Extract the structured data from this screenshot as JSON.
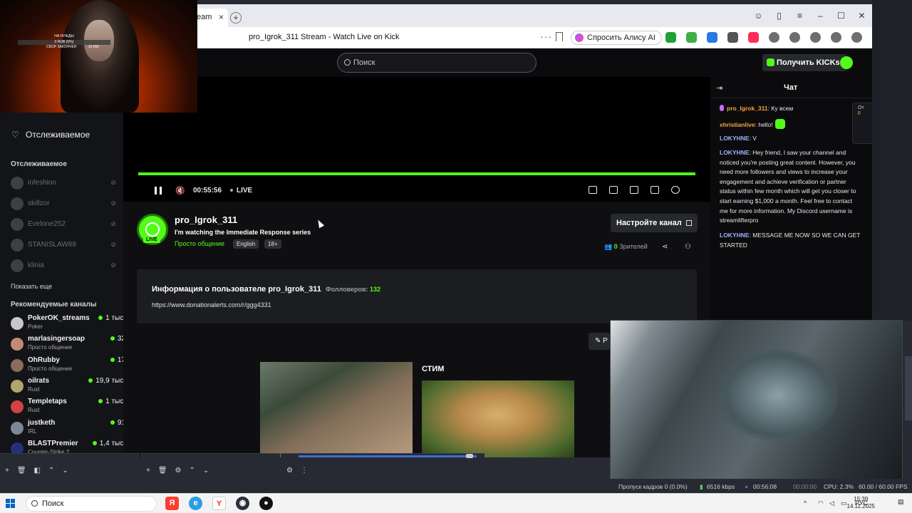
{
  "browser": {
    "tab_label": "eam",
    "tab_close": "×",
    "new_tab": "+",
    "page_title": "pro_Igrok_311 Stream - Watch Live on Kick",
    "alice_label": "Спросить Алису AI",
    "win_controls": [
      "☺",
      "▯",
      "≡",
      "–",
      "☐",
      "✕"
    ],
    "ext_colors": [
      "#21a038",
      "#3fae45",
      "#2a7ae2",
      "#555555",
      "#ff2d55",
      "#555555",
      "#555555",
      "#555555",
      "#555555",
      "#555555"
    ]
  },
  "kick": {
    "search_placeholder": "Поиск",
    "get_kicks_label": "Получить KICKs",
    "accent": "#53fc18"
  },
  "sidebar": {
    "following_link": "Отслеживаемое",
    "following_header": "Отслеживаемое",
    "offline": [
      "infeshion",
      "skillzor",
      "Evelone252",
      "STANISLAW89",
      "klinia"
    ],
    "show_more": "Показать еще",
    "recommended_header": "Рекомендуемые каналы",
    "recommended": [
      {
        "name": "PokerOK_streams",
        "category": "Poker",
        "viewers": "1 тыс.",
        "color": "#c8c8c8"
      },
      {
        "name": "marlasingersoap",
        "category": "Просто общение",
        "viewers": "32",
        "color": "#c28a73"
      },
      {
        "name": "OhRubby",
        "category": "Просто общение",
        "viewers": "17",
        "color": "#8b6b5c"
      },
      {
        "name": "oilrats",
        "category": "Rust",
        "viewers": "19,9 тыс.",
        "color": "#b0a56a"
      },
      {
        "name": "Templetaps",
        "category": "Rust",
        "viewers": "1 тыс.",
        "color": "#d34242"
      },
      {
        "name": "justketh",
        "category": "IRL",
        "viewers": "91",
        "color": "#7b8794"
      },
      {
        "name": "BLASTPremier",
        "category": "Counter-Strike 2",
        "viewers": "1,4 тыс.",
        "color": "#26307a"
      }
    ]
  },
  "webcam": {
    "overlay_line1": "НА НУЖДЫ",
    "overlay_line2": "0 RUB (0%)",
    "overlay_line3": "СБОР ЗАКОНЧЕН",
    "overlay_line4": "10 000"
  },
  "player": {
    "time": "00:55:56",
    "live_label": "LIVE",
    "progress": 1.0
  },
  "channel": {
    "name": "pro_Igrok_311",
    "stream_title": "I'm watching the Immediate Response series",
    "category": "Просто общение",
    "tags": [
      "English",
      "18+"
    ],
    "live_badge": "LIVE",
    "setup_button": "Настройте канал",
    "viewers_count": "0",
    "viewers_label": "Зрителей",
    "about_title": "Информация о пользователе pro_Igrok_311",
    "followers_label": "Фолловеров:",
    "followers_count": "132",
    "link": "https://www.donationalerts.com/r/ggg4331",
    "edit_label": "✎ Р",
    "panel_title": "СТИМ"
  },
  "chat": {
    "title": "Чат",
    "pinned_line1": "От",
    "pinned_line2": "р",
    "messages": [
      {
        "user": "pro_Igrok_311",
        "text": "Ку всем",
        "color": "#f6a23a",
        "mod": true
      },
      {
        "user": "xhristianlive",
        "text": "hello!",
        "color": "#f6a23a",
        "emote": true
      },
      {
        "user": "LOKYHNE",
        "text": "V",
        "color": "#9fb4ff"
      },
      {
        "user": "LOKYHNE",
        "text": "Hey friend, I saw your channel and noticed you're posting great content. However, you need more followers and views to increase your engagement and achieve verification or partner status within few month which will get you closer to start earning $1,000 a month. Feel free to contact me for more information. My Discord username is streamlifterpro",
        "color": "#9fb4ff"
      },
      {
        "user": "LOKYHNE",
        "text": "MESSAGE ME NOW SO WE CAN GET STARTED",
        "color": "#9fb4ff"
      }
    ]
  },
  "obs": {
    "dropped_frames": "Пропуск кадров 0 (0.0%)",
    "bitrate": "6516 kbps",
    "stream_time": "00:56:08",
    "rec_time": "00:00:00",
    "cpu": "CPU: 2.3%",
    "fps": "60.00 / 60.00 FPS"
  },
  "taskbar": {
    "search_label": "Поиск",
    "lang": "РУС",
    "time": "15:39",
    "date": "14.11.2025"
  }
}
